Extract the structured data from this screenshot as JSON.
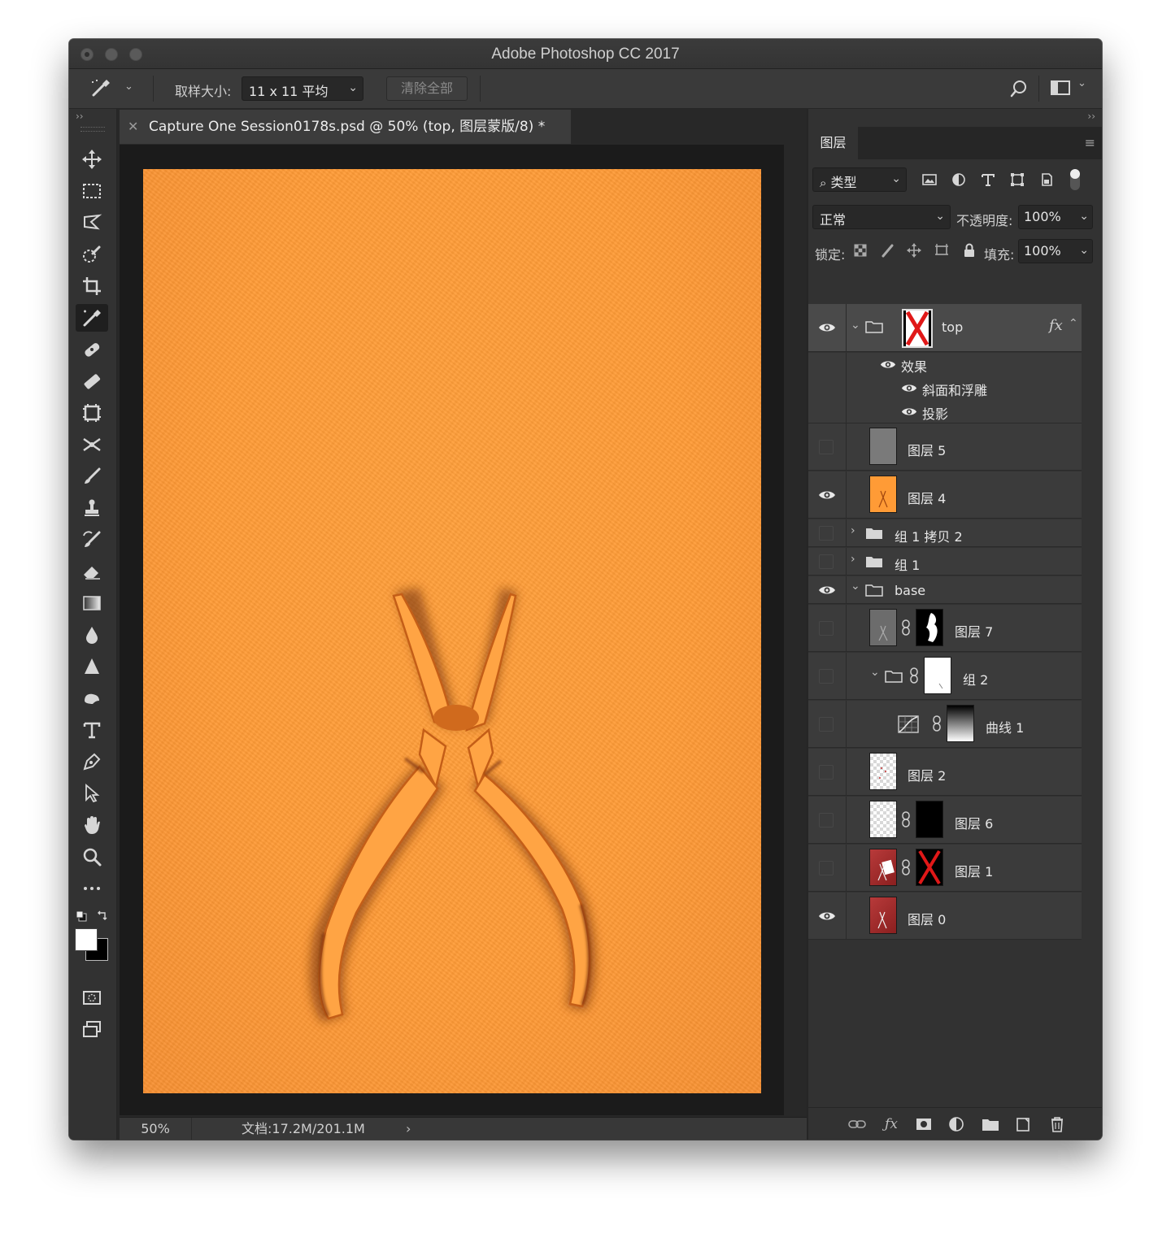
{
  "window": {
    "title": "Adobe Photoshop CC 2017"
  },
  "options_bar": {
    "sample_size_label": "取样大小:",
    "sample_size_value": "11 x 11 平均",
    "clear_all_label": "清除全部"
  },
  "document": {
    "tab_title": "Capture One Session0178s.psd @ 50% (top, 图层蒙版/8) *",
    "zoom": "50%",
    "doc_size": "文档:17.2M/201.1M"
  },
  "layers_panel": {
    "tab_label": "图层",
    "filter_kind": "类型",
    "blend_mode": "正常",
    "opacity_label": "不透明度:",
    "opacity_value": "100%",
    "lock_label": "锁定:",
    "fill_label": "填充:",
    "fill_value": "100%",
    "layers": {
      "top": {
        "name": "top",
        "fx": "fx"
      },
      "effects_label": "效果",
      "bevel_label": "斜面和浮雕",
      "shadow_label": "投影",
      "layer5": "图层 5",
      "layer4": "图层 4",
      "group1copy2": "组 1 拷贝 2",
      "group1": "组 1",
      "base": "base",
      "layer7": "图层 7",
      "group2": "组 2",
      "curves1": "曲线 1",
      "layer2": "图层 2",
      "layer6": "图层 6",
      "layer1": "图层 1",
      "layer0": "图层 0"
    }
  },
  "colors": {
    "canvas_orange": "#ff9b36",
    "ui_dark": "#323232",
    "selected_row": "#4a4a4a"
  }
}
